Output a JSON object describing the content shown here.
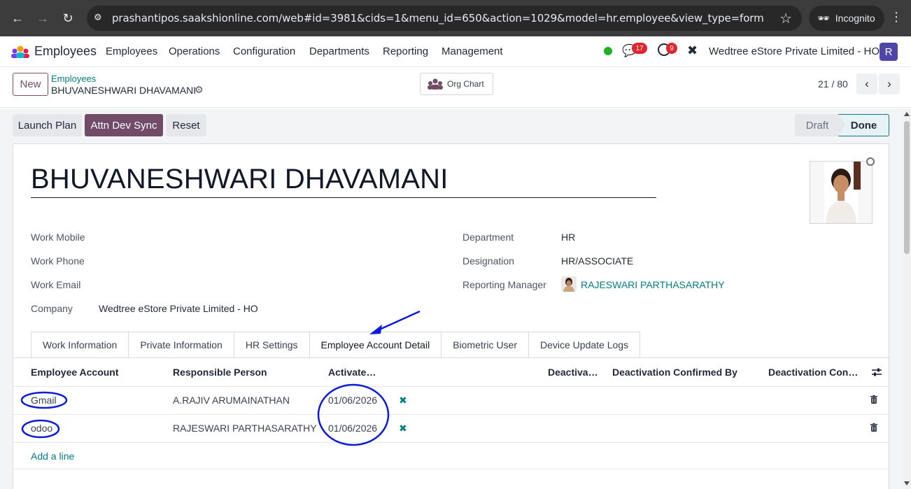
{
  "browser": {
    "url": "prashantipos.saakshionline.com/web#id=3981&cids=1&menu_id=650&action=1029&model=hr.employee&view_type=form",
    "incognito_label": "Incognito"
  },
  "topnav": {
    "app_name": "Employees",
    "menus": [
      "Employees",
      "Operations",
      "Configuration",
      "Departments",
      "Reporting",
      "Management"
    ],
    "chat_count": "17",
    "activity_count": "9",
    "company": "Wedtree eStore Private Limited - HO",
    "user_initial": "R"
  },
  "control": {
    "new_label": "New",
    "breadcrumb_parent": "Employees",
    "breadcrumb_current": "BHUVANESHWARI DHAVAMANI",
    "org_chart_label": "Org Chart",
    "pager": "21 / 80"
  },
  "header_buttons": {
    "launch_plan": "Launch Plan",
    "attn_dev_sync": "Attn Dev Sync",
    "reset": "Reset"
  },
  "status": {
    "draft": "Draft",
    "done": "Done"
  },
  "employee": {
    "name": "BHUVANESHWARI DHAVAMANI",
    "work_mobile_label": "Work Mobile",
    "work_phone_label": "Work Phone",
    "work_email_label": "Work Email",
    "company_label": "Company",
    "company_value": "Wedtree eStore Private Limited - HO",
    "department_label": "Department",
    "department_value": "HR",
    "designation_label": "Designation",
    "designation_value": "HR/ASSOCIATE",
    "manager_label": "Reporting Manager",
    "manager_value": "RAJESWARI PARTHASARATHY"
  },
  "tabs": [
    "Work Information",
    "Private Information",
    "HR Settings",
    "Employee Account Detail",
    "Biometric User",
    "Device Update Logs"
  ],
  "table": {
    "headers": [
      "Employee Account",
      "Responsible Person",
      "Activate…",
      "Deactiva…",
      "Deactivation Confirmed By",
      "Deactivation Con…"
    ],
    "rows": [
      {
        "account": "Gmail",
        "person": "A.RAJIV ARUMAINATHAN",
        "activate": "01/06/2026"
      },
      {
        "account": "odoo",
        "person": "RAJESWARI PARTHASARATHY",
        "activate": "01/06/2026"
      }
    ],
    "add_line": "Add a line"
  },
  "colors": {
    "brand": "#714b67",
    "link": "#017e84",
    "annotation": "#0b1bd6"
  }
}
